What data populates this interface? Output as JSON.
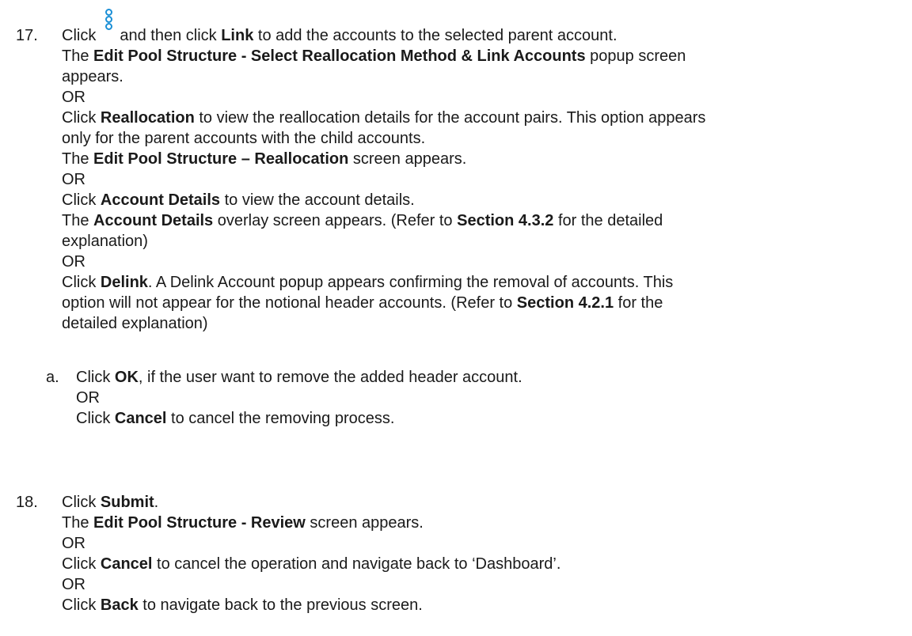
{
  "step17": {
    "number": "17.",
    "line1": {
      "t1": "Click",
      "t2": "and then click ",
      "b1": "Link",
      "t3": " to add the accounts to the selected parent account."
    },
    "line2": {
      "t1": "The ",
      "b1": "Edit Pool Structure - Select Reallocation Method & Link Accounts",
      "t2": " popup screen"
    },
    "line3": "appears.",
    "or1": "OR",
    "line5": {
      "t1": "Click ",
      "b1": "Reallocation",
      "t2": " to view the reallocation details for the account pairs. This option appears"
    },
    "line6": "only for the parent accounts with the child accounts.",
    "line7": {
      "t1": "The ",
      "b1": "Edit Pool Structure – Reallocation",
      "t2": " screen appears."
    },
    "or2": "OR",
    "line9": {
      "t1": "Click ",
      "b1": "Account Details",
      "t2": " to view the account details."
    },
    "line10": {
      "t1": "The ",
      "b1": "Account Details",
      "t2": " overlay screen appears. (Refer to ",
      "b2": "Section 4.3.2",
      "t3": " for the detailed"
    },
    "line11": "explanation)",
    "or3": "OR",
    "line13": {
      "t1": "Click ",
      "b1": "Delink",
      "t2": ". A Delink Account popup appears confirming the removal of accounts. This"
    },
    "line14": {
      "t1": "option will not appear for the notional header accounts. (Refer to ",
      "b1": "Section 4.2.1",
      "t2": " for the"
    },
    "line15": "detailed explanation)",
    "sub_a": {
      "letter": "a.",
      "line1": {
        "t1": "Click ",
        "b1": "OK",
        "t2": ", if the user want to remove the added header account."
      },
      "or": "OR",
      "line3": {
        "t1": "Click ",
        "b1": "Cancel",
        "t2": " to cancel the removing process."
      }
    }
  },
  "step18": {
    "number": "18.",
    "line1": {
      "t1": "Click ",
      "b1": "Submit",
      "t2": "."
    },
    "line2": {
      "t1": "The ",
      "b1": "Edit Pool Structure - Review",
      "t2": " screen appears."
    },
    "or1": "OR",
    "line4": {
      "t1": "Click ",
      "b1": "Cancel",
      "t2": " to cancel the operation and navigate back to ‘Dashboard’."
    },
    "or2": "OR",
    "line6": {
      "t1": "Click ",
      "b1": "Back",
      "t2": " to navigate back to the previous screen."
    }
  },
  "icons": {
    "kebab": "vertical-ellipsis-icon",
    "accent": "#1a8fd6"
  }
}
